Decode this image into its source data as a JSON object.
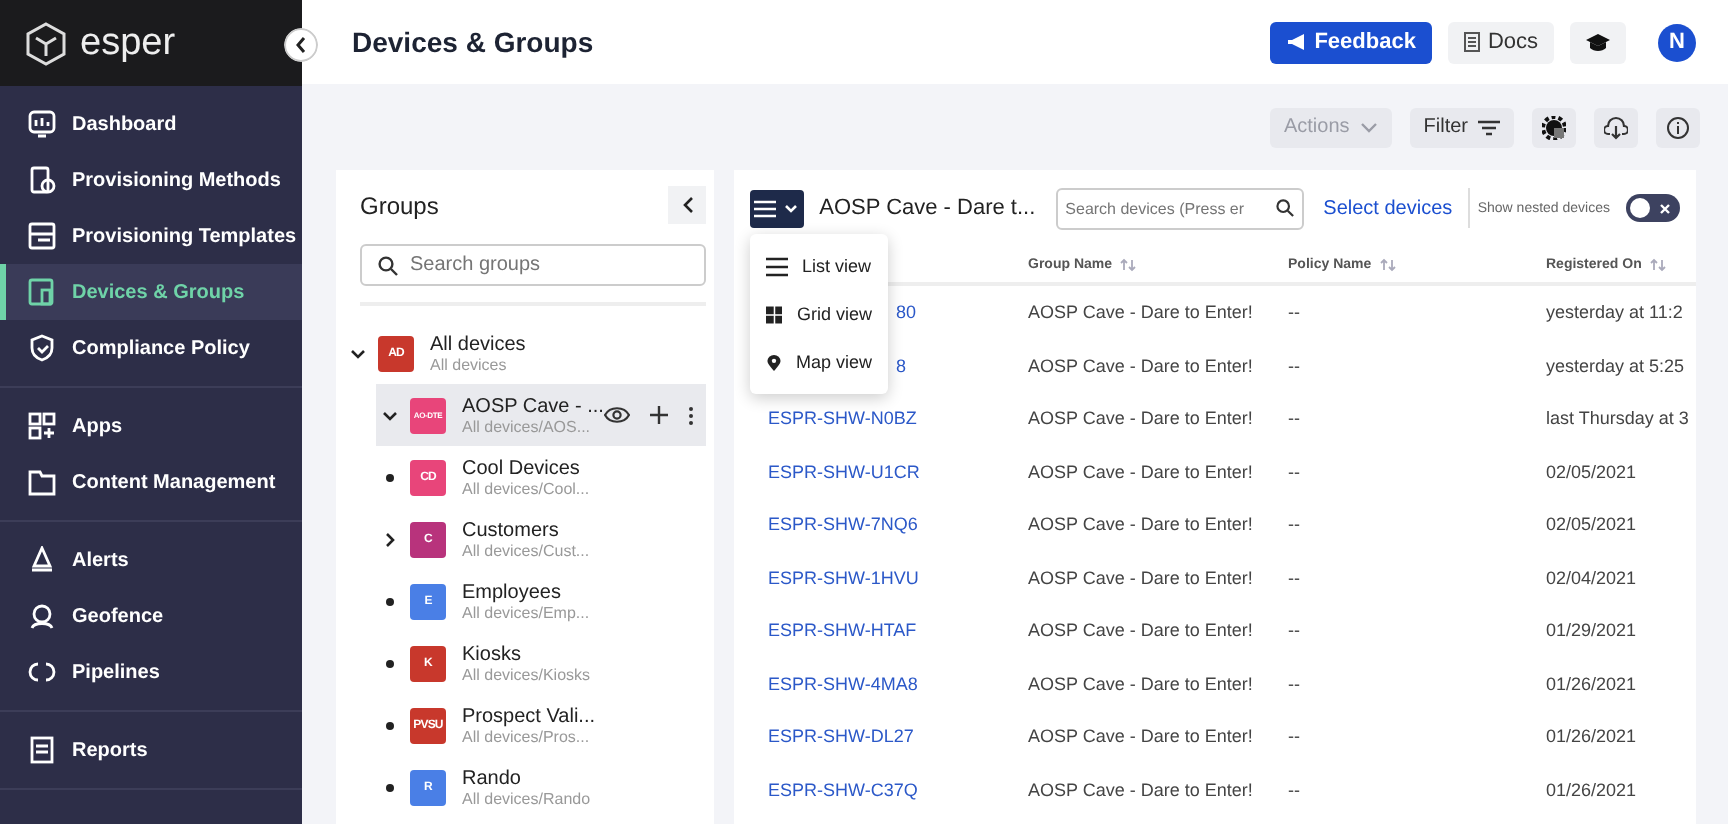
{
  "sidebar": {
    "logo": "esper",
    "sections": [
      [
        {
          "label": "Dashboard",
          "selected": false
        },
        {
          "label": "Provisioning Methods",
          "selected": false
        },
        {
          "label": "Provisioning Templates",
          "selected": false
        },
        {
          "label": "Devices & Groups",
          "selected": true
        },
        {
          "label": "Compliance Policy",
          "selected": false
        }
      ],
      [
        {
          "label": "Apps",
          "selected": false
        },
        {
          "label": "Content Management",
          "selected": false
        }
      ],
      [
        {
          "label": "Alerts",
          "selected": false
        },
        {
          "label": "Geofence",
          "selected": false
        },
        {
          "label": "Pipelines",
          "selected": false
        }
      ],
      [
        {
          "label": "Reports",
          "selected": false
        }
      ]
    ]
  },
  "header": {
    "title": "Devices & Groups",
    "feedback": "Feedback",
    "docs": "Docs",
    "avatar": "N"
  },
  "toolbar": {
    "actions": {
      "label": "Actions",
      "disabled": true
    },
    "filter": "Filter"
  },
  "groups": {
    "title": "Groups",
    "search_placeholder": "Search groups",
    "tree": [
      {
        "kind": "folder",
        "expanded": true,
        "selected": false,
        "badge": "AD",
        "color": "#c8382c",
        "name": "All devices",
        "path": "All devices",
        "children": [
          {
            "kind": "folder",
            "expanded": true,
            "selected": true,
            "badge": "AO-DTE",
            "color": "#e8457a",
            "name": "AOSP Cave - ...",
            "path": "All devices/AOS..."
          },
          {
            "kind": "leaf",
            "selected": false,
            "badge": "CD",
            "color": "#e8457a",
            "name": "Cool Devices",
            "path": "All devices/Cool..."
          },
          {
            "kind": "folder",
            "expanded": false,
            "selected": false,
            "badge": "C",
            "color": "#b8337c",
            "name": "Customers",
            "path": "All devices/Cust..."
          },
          {
            "kind": "leaf",
            "selected": false,
            "badge": "E",
            "color": "#4a7fe6",
            "name": "Employees",
            "path": "All devices/Emp..."
          },
          {
            "kind": "leaf",
            "selected": false,
            "badge": "K",
            "color": "#c8382c",
            "name": "Kiosks",
            "path": "All devices/Kiosks"
          },
          {
            "kind": "leaf",
            "selected": false,
            "badge": "PVSU",
            "color": "#c8382c",
            "name": "Prospect Vali...",
            "path": "All devices/Pros..."
          },
          {
            "kind": "leaf",
            "selected": false,
            "badge": "R",
            "color": "#4a7fe6",
            "name": "Rando",
            "path": "All devices/Rando"
          }
        ]
      }
    ]
  },
  "devices": {
    "group_title": "AOSP Cave - Dare t...",
    "search_placeholder": "Search devices (Press er",
    "select_link": "Select devices",
    "nested_label": "Show nested devices",
    "nested_on": false,
    "view_menu": [
      "List view",
      "Grid view",
      "Map view"
    ],
    "columns": [
      "Group Name",
      "Policy Name",
      "Registered On"
    ],
    "rows": [
      {
        "covered": true,
        "device": "80",
        "group": "AOSP Cave - Dare to Enter!",
        "policy": "--",
        "registered": "yesterday at 11:2"
      },
      {
        "covered": true,
        "device": "8",
        "group": "AOSP Cave - Dare to Enter!",
        "policy": "--",
        "registered": "yesterday at 5:25"
      },
      {
        "covered": false,
        "device": "ESPR-SHW-N0BZ",
        "group": "AOSP Cave - Dare to Enter!",
        "policy": "--",
        "registered": "last Thursday at 3"
      },
      {
        "covered": false,
        "device": "ESPR-SHW-U1CR",
        "group": "AOSP Cave - Dare to Enter!",
        "policy": "--",
        "registered": "02/05/2021"
      },
      {
        "covered": false,
        "device": "ESPR-SHW-7NQ6",
        "group": "AOSP Cave - Dare to Enter!",
        "policy": "--",
        "registered": "02/05/2021"
      },
      {
        "covered": false,
        "device": "ESPR-SHW-1HVU",
        "group": "AOSP Cave - Dare to Enter!",
        "policy": "--",
        "registered": "02/04/2021"
      },
      {
        "covered": false,
        "device": "ESPR-SHW-HTAF",
        "group": "AOSP Cave - Dare to Enter!",
        "policy": "--",
        "registered": "01/29/2021"
      },
      {
        "covered": false,
        "device": "ESPR-SHW-4MA8",
        "group": "AOSP Cave - Dare to Enter!",
        "policy": "--",
        "registered": "01/26/2021"
      },
      {
        "covered": false,
        "device": "ESPR-SHW-DL27",
        "group": "AOSP Cave - Dare to Enter!",
        "policy": "--",
        "registered": "01/26/2021"
      },
      {
        "covered": false,
        "device": "ESPR-SHW-C37Q",
        "group": "AOSP Cave - Dare to Enter!",
        "policy": "--",
        "registered": "01/26/2021"
      }
    ]
  }
}
